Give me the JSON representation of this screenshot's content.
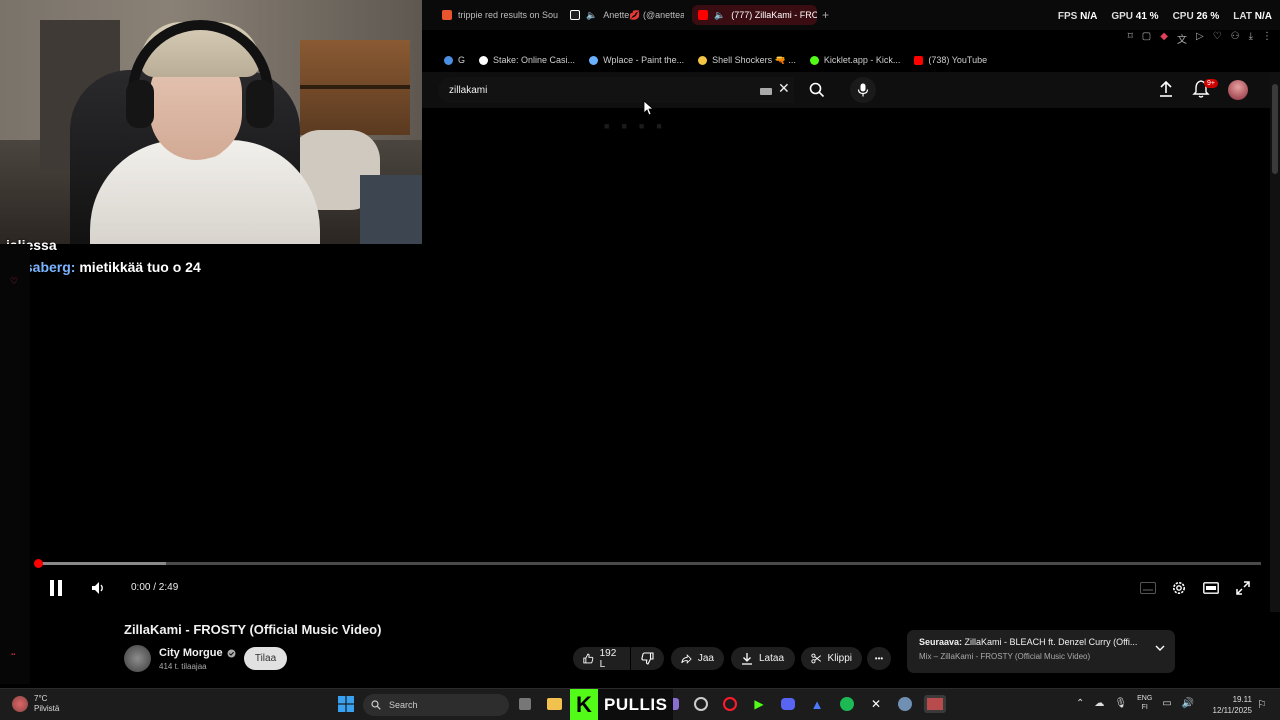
{
  "webcam": {
    "description_name": "streamer-webcam"
  },
  "chat": [
    {
      "user": "",
      "message": "jaljessa"
    },
    {
      "user": "Kasaberg:",
      "message": "mietikkää tuo o 24"
    }
  ],
  "browser": {
    "tabs": [
      {
        "label": "trippie red results on Sou",
        "color": "#e8542b",
        "active": false
      },
      {
        "label": "Anette💋 (@anetteali",
        "color": "#ffffff",
        "active": false
      },
      {
        "label": "(777) ZillaKami - FRO",
        "color": "#ff0000",
        "active": true
      }
    ],
    "add_tab": "+",
    "stats": {
      "fps_label": "FPS",
      "fps_value": "N/A",
      "gpu_label": "GPU",
      "gpu_value": "41 %",
      "cpu_label": "CPU",
      "cpu_value": "26 %",
      "lat_label": "LAT",
      "lat_value": "N/A"
    },
    "bookmarks": [
      {
        "label": "G",
        "color": "#4a90e2"
      },
      {
        "label": "Stake: Online Casi...",
        "color": "#ffffff"
      },
      {
        "label": "Wplace - Paint the...",
        "color": "#6ab0ff"
      },
      {
        "label": "Shell Shockers 🔫 ...",
        "color": "#f4c542"
      },
      {
        "label": "Kicklet.app - Kick...",
        "color": "#53fc18"
      },
      {
        "label": "(738) YouTube",
        "color": "#ff0000"
      }
    ]
  },
  "youtube": {
    "search_value": "zillakami",
    "notification_badge": "9+",
    "player": {
      "time_display": "0:00 / 2:49",
      "progress_fraction": 0.0,
      "buffered_fraction": 0.105
    },
    "video": {
      "title": "ZillaKami - FROSTY (Official Music Video)",
      "channel": "City Morgue",
      "subscribers": "414 t. tilaajaa",
      "subscribe_label": "Tilaa",
      "like_count": "192 L",
      "share_label": "Jaa",
      "download_label": "Lataa",
      "clip_label": "Klippi",
      "more_label": "•••"
    },
    "up_next": {
      "prefix": "Seuraava:",
      "title": "ZillaKami - BLEACH ft. Denzel Curry (Offi...",
      "mix": "Mix – ZillaKami - FROSTY (Official Music Video)"
    }
  },
  "taskbar": {
    "weather_temp": "7°C",
    "weather_desc": "Pilvistä",
    "search_label": "Search",
    "pinned_app_name": "PULLIS",
    "pinned_app_letter": "K",
    "lang_line1": "ENG",
    "lang_line2": "FI",
    "time": "19.11",
    "date": "12/11/2025"
  },
  "colors": {
    "accent": "#ff0000",
    "kick_green": "#53fc18",
    "chat_user": "#7ab4ff"
  }
}
